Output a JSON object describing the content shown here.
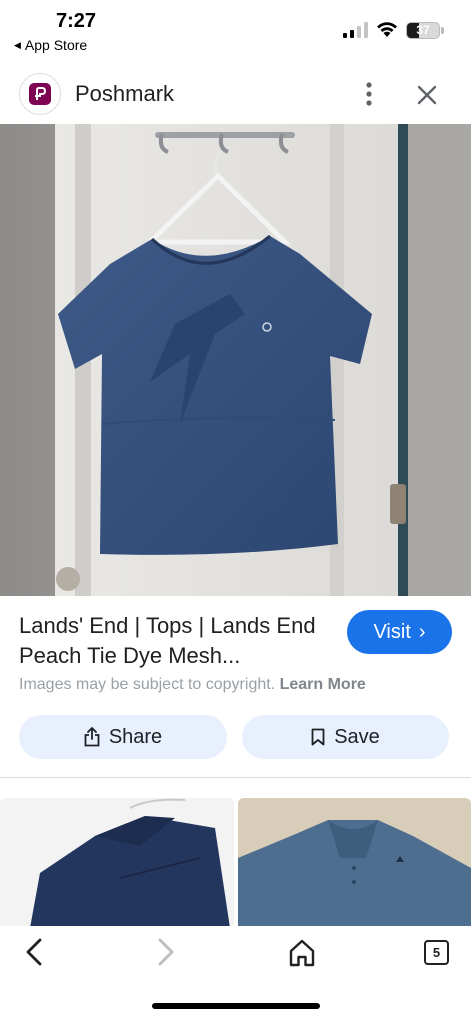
{
  "status_bar": {
    "time": "7:27",
    "back_app": "App Store",
    "back_arrow": "◀",
    "battery": "37",
    "battery_level": 0.37
  },
  "source": {
    "name": "Poshmark",
    "logo_icon": "poshmark-logo",
    "brand_color": "#7f0353"
  },
  "result": {
    "title": "Lands' End | Tops | Lands End Peach Tie Dye Mesh...",
    "visit_label": "Visit",
    "visit_chevron": "›",
    "copyright_text": "Images may be subject to copyright.",
    "learn_more": "Learn More",
    "share_label": "Share",
    "save_label": "Save"
  },
  "toolbar": {
    "tab_count": "5"
  },
  "colors": {
    "accent": "#1a73e8",
    "chip_bg": "#e8f0fe"
  }
}
